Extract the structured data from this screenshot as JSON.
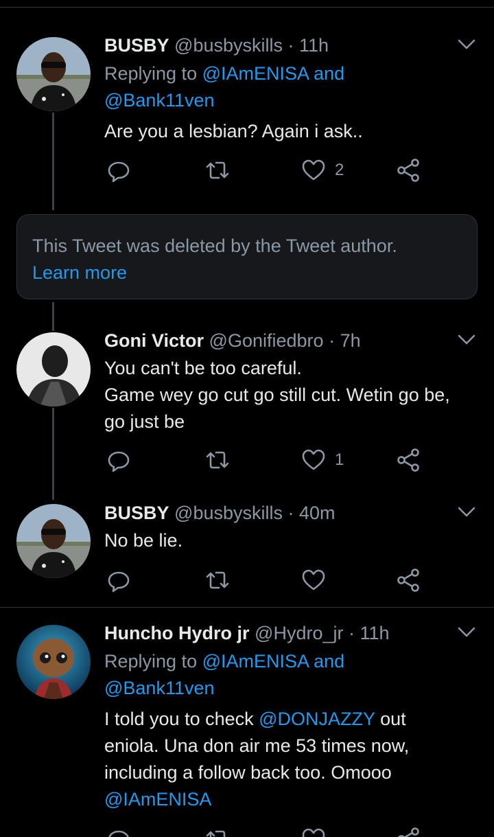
{
  "tweets": [
    {
      "name": "BUSBY",
      "handle": "@busbyskills",
      "dot": "·",
      "time": "11h",
      "replying_prefix": "Replying to",
      "replying_1": "@IAmENISA",
      "replying_and": "and",
      "replying_2": "@Bank11ven",
      "text": "Are you a lesbian? Again i ask..",
      "likes": "2"
    },
    {
      "name": "Goni Victor",
      "handle": "@Gonifiedbro",
      "dot": "·",
      "time": "7h",
      "text_line1": "You can't be too careful.",
      "text_line2": "Game wey go cut go still cut. Wetin go be, go just be",
      "likes": "1"
    },
    {
      "name": "BUSBY",
      "handle": "@busbyskills",
      "dot": "·",
      "time": "40m",
      "text": "No be lie."
    },
    {
      "name": "Huncho Hydro jr",
      "handle": "@Hydro_jr",
      "dot": "·",
      "time": "11h",
      "replying_prefix": "Replying to",
      "replying_1": "@IAmENISA",
      "replying_and": "and",
      "replying_2": "@Bank11ven",
      "text_a": "I told you to check",
      "text_mention": "@DONJAZZY",
      "text_b": "out eniola. Una don air me 53 times now, including a follow back too. Omooo",
      "text_mention2": "@IAmENISA"
    }
  ],
  "deleted_notice": {
    "message": "This Tweet was deleted by the Tweet author.",
    "learn_more": "Learn more"
  },
  "icons": {
    "reply": "reply-icon",
    "retweet": "retweet-icon",
    "like": "heart-icon",
    "share": "share-icon",
    "more": "chevron-down-icon"
  },
  "colors": {
    "background": "#000000",
    "link": "#1d9bf0",
    "muted": "#8b98a5",
    "text": "#e7e9ea"
  }
}
